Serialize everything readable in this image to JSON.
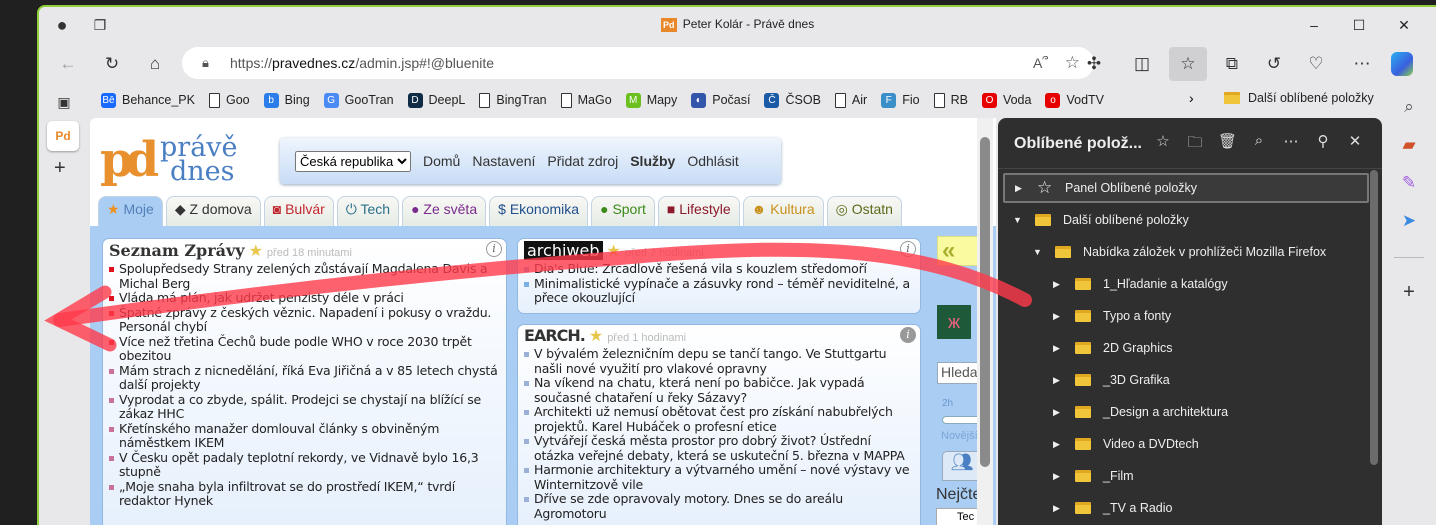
{
  "window": {
    "title": "Peter Kolár - Právě dnes",
    "favicon": "Pd"
  },
  "controls": {
    "minimize": "–",
    "maximize": "☐",
    "close": "✕"
  },
  "address": {
    "scheme": "https://",
    "domain": "pravednes.cz",
    "path": "/admin.jsp#!@bluenite"
  },
  "bookmarks": [
    {
      "label": "Behance_PK",
      "icon": "Bē",
      "color": "#1769ff"
    },
    {
      "label": "Goo",
      "icon": "page",
      "color": ""
    },
    {
      "label": "Bing",
      "icon": "b",
      "color": "#2b7de9"
    },
    {
      "label": "GooTran",
      "icon": "G",
      "color": "#4a8af4"
    },
    {
      "label": "DeepL",
      "icon": "D",
      "color": "#0f2b46"
    },
    {
      "label": "BingTran",
      "icon": "page",
      "color": ""
    },
    {
      "label": "MaGo",
      "icon": "page",
      "color": ""
    },
    {
      "label": "Mapy",
      "icon": "M",
      "color": "#6bbf1f"
    },
    {
      "label": "Počasí",
      "icon": "◐",
      "color": "#3355aa"
    },
    {
      "label": "ČSOB",
      "icon": "Č",
      "color": "#1a5aa6"
    },
    {
      "label": "Air",
      "icon": "page",
      "color": ""
    },
    {
      "label": "Fio",
      "icon": "F",
      "color": "#3b8fc8"
    },
    {
      "label": "RB",
      "icon": "page",
      "color": ""
    },
    {
      "label": "Voda",
      "icon": "O",
      "color": "#e60000"
    },
    {
      "label": "VodTV",
      "icon": "o",
      "color": "#e60000"
    }
  ],
  "bookmarks_more": "Další oblíbené položky",
  "site": {
    "logo_mark": "pd",
    "logo_text1": "právě",
    "logo_text2": "dnes",
    "region": "Česká republika",
    "nav": [
      "Domů",
      "Nastavení",
      "Přidat zdroj",
      "Služby",
      "Odhlásit"
    ],
    "tabs": [
      {
        "label": "Moje",
        "icon": "★",
        "color": "#5480b8"
      },
      {
        "label": "Z domova",
        "icon": "◆",
        "color": "#333"
      },
      {
        "label": "Bulvár",
        "icon": "◙",
        "color": "#c0282d"
      },
      {
        "label": "Tech",
        "icon": "⏻",
        "color": "#2a6f8a"
      },
      {
        "label": "Ze světa",
        "icon": "●",
        "color": "#7a2a8c"
      },
      {
        "label": "Ekonomika",
        "icon": "$",
        "color": "#1f4f8c"
      },
      {
        "label": "Sport",
        "icon": "●",
        "color": "#3b8a1a"
      },
      {
        "label": "Lifestyle",
        "icon": "■",
        "color": "#8c1a2a"
      },
      {
        "label": "Kultura",
        "icon": "☻",
        "color": "#c8901a"
      },
      {
        "label": "Ostatn",
        "icon": "◎",
        "color": "#5a6a1a"
      }
    ],
    "cards": [
      {
        "title": "Seznam Zprávy",
        "time": "před 18 minutami",
        "items": [
          "Spolupředsedy Strany zelených zůstávají Magdalena Davis a Michal Berg",
          "Vláda má plán, jak udržet penzisty déle v práci",
          "Špatné zprávy z českých věznic. Napadení i pokusy o vraždu. Personál chybí",
          "Více než třetina Čechů bude podle WHO v roce 2030 trpět obezitou",
          "Mám strach z nicnedělání, říká Eva Jiřičná a v 85 letech chystá další projekty",
          "Vyprodat a co zbyde, spálit. Prodejci se chystají na blížící se zákaz HHC",
          "Křetínského manažer domlouval články s obviněným náměstkem IKEM",
          "V Česku opět padaly teplotní rekordy, ve Vidnavě bylo 16,3 stupně",
          "„Moje snaha byla infiltrovat se do prostředí IKEM,“ tvrdí redaktor Hynek"
        ]
      },
      {
        "title": "archiweb",
        "time": "před 7 hodinami",
        "items": [
          "Dia's Blue: Zrcadlově řešená vila s kouzlem středomoří",
          "Minimalistické vypínače a zásuvky rond – téměř neviditelné, a přece okouzlující"
        ]
      },
      {
        "title": "EARCH.",
        "time": "před 1 hodinami",
        "items": [
          "V bývalém železničním depu se tančí tango. Ve Stuttgartu našli nové využití pro vlakové opravny",
          "Na víkend na chatu, která není po babičce. Jak vypadá současné chataření u řeky Sázavy?",
          "Architekti už nemusí obětovat čest pro získání nabubřelých projektů. Karel Hubáček o profesní etice",
          "Vytvářejí česká města prostor pro dobrý život? Ústřední otázka veřejné debaty, která se uskuteční 5. března v MAPPA",
          "Harmonie architektury a výtvarného umění – nové výstavy ve Winternitzově vile",
          "Dříve se zde opravovaly motory. Dnes se do areálu Agromotoru"
        ]
      }
    ],
    "side": {
      "search_placeholder": "Hledat",
      "slider_label": "2h",
      "newer": "Novější",
      "most_read": "Nejčte",
      "tech": "Tec"
    }
  },
  "favorites": {
    "title": "Oblíbené polož...",
    "items": [
      {
        "label": "Panel Oblíbené položky",
        "level": 0,
        "expanded": false,
        "type": "star"
      },
      {
        "label": "Další oblíbené položky",
        "level": 0,
        "expanded": true,
        "type": "folder"
      },
      {
        "label": "Nabídka záložek v prohlížeči Mozilla Firefox",
        "level": 1,
        "expanded": true,
        "type": "folder"
      },
      {
        "label": "1_Hľadanie a katalógy",
        "level": 2,
        "expanded": false,
        "type": "folder"
      },
      {
        "label": "Typo a fonty",
        "level": 2,
        "expanded": false,
        "type": "folder"
      },
      {
        "label": "2D Graphics",
        "level": 2,
        "expanded": false,
        "type": "folder"
      },
      {
        "label": "_3D Grafika",
        "level": 2,
        "expanded": false,
        "type": "folder"
      },
      {
        "label": "_Design a architektura",
        "level": 2,
        "expanded": false,
        "type": "folder"
      },
      {
        "label": "Video a DVDtech",
        "level": 2,
        "expanded": false,
        "type": "folder"
      },
      {
        "label": "_Film",
        "level": 2,
        "expanded": false,
        "type": "folder"
      },
      {
        "label": "_TV a Radio",
        "level": 2,
        "expanded": false,
        "type": "folder"
      }
    ]
  }
}
